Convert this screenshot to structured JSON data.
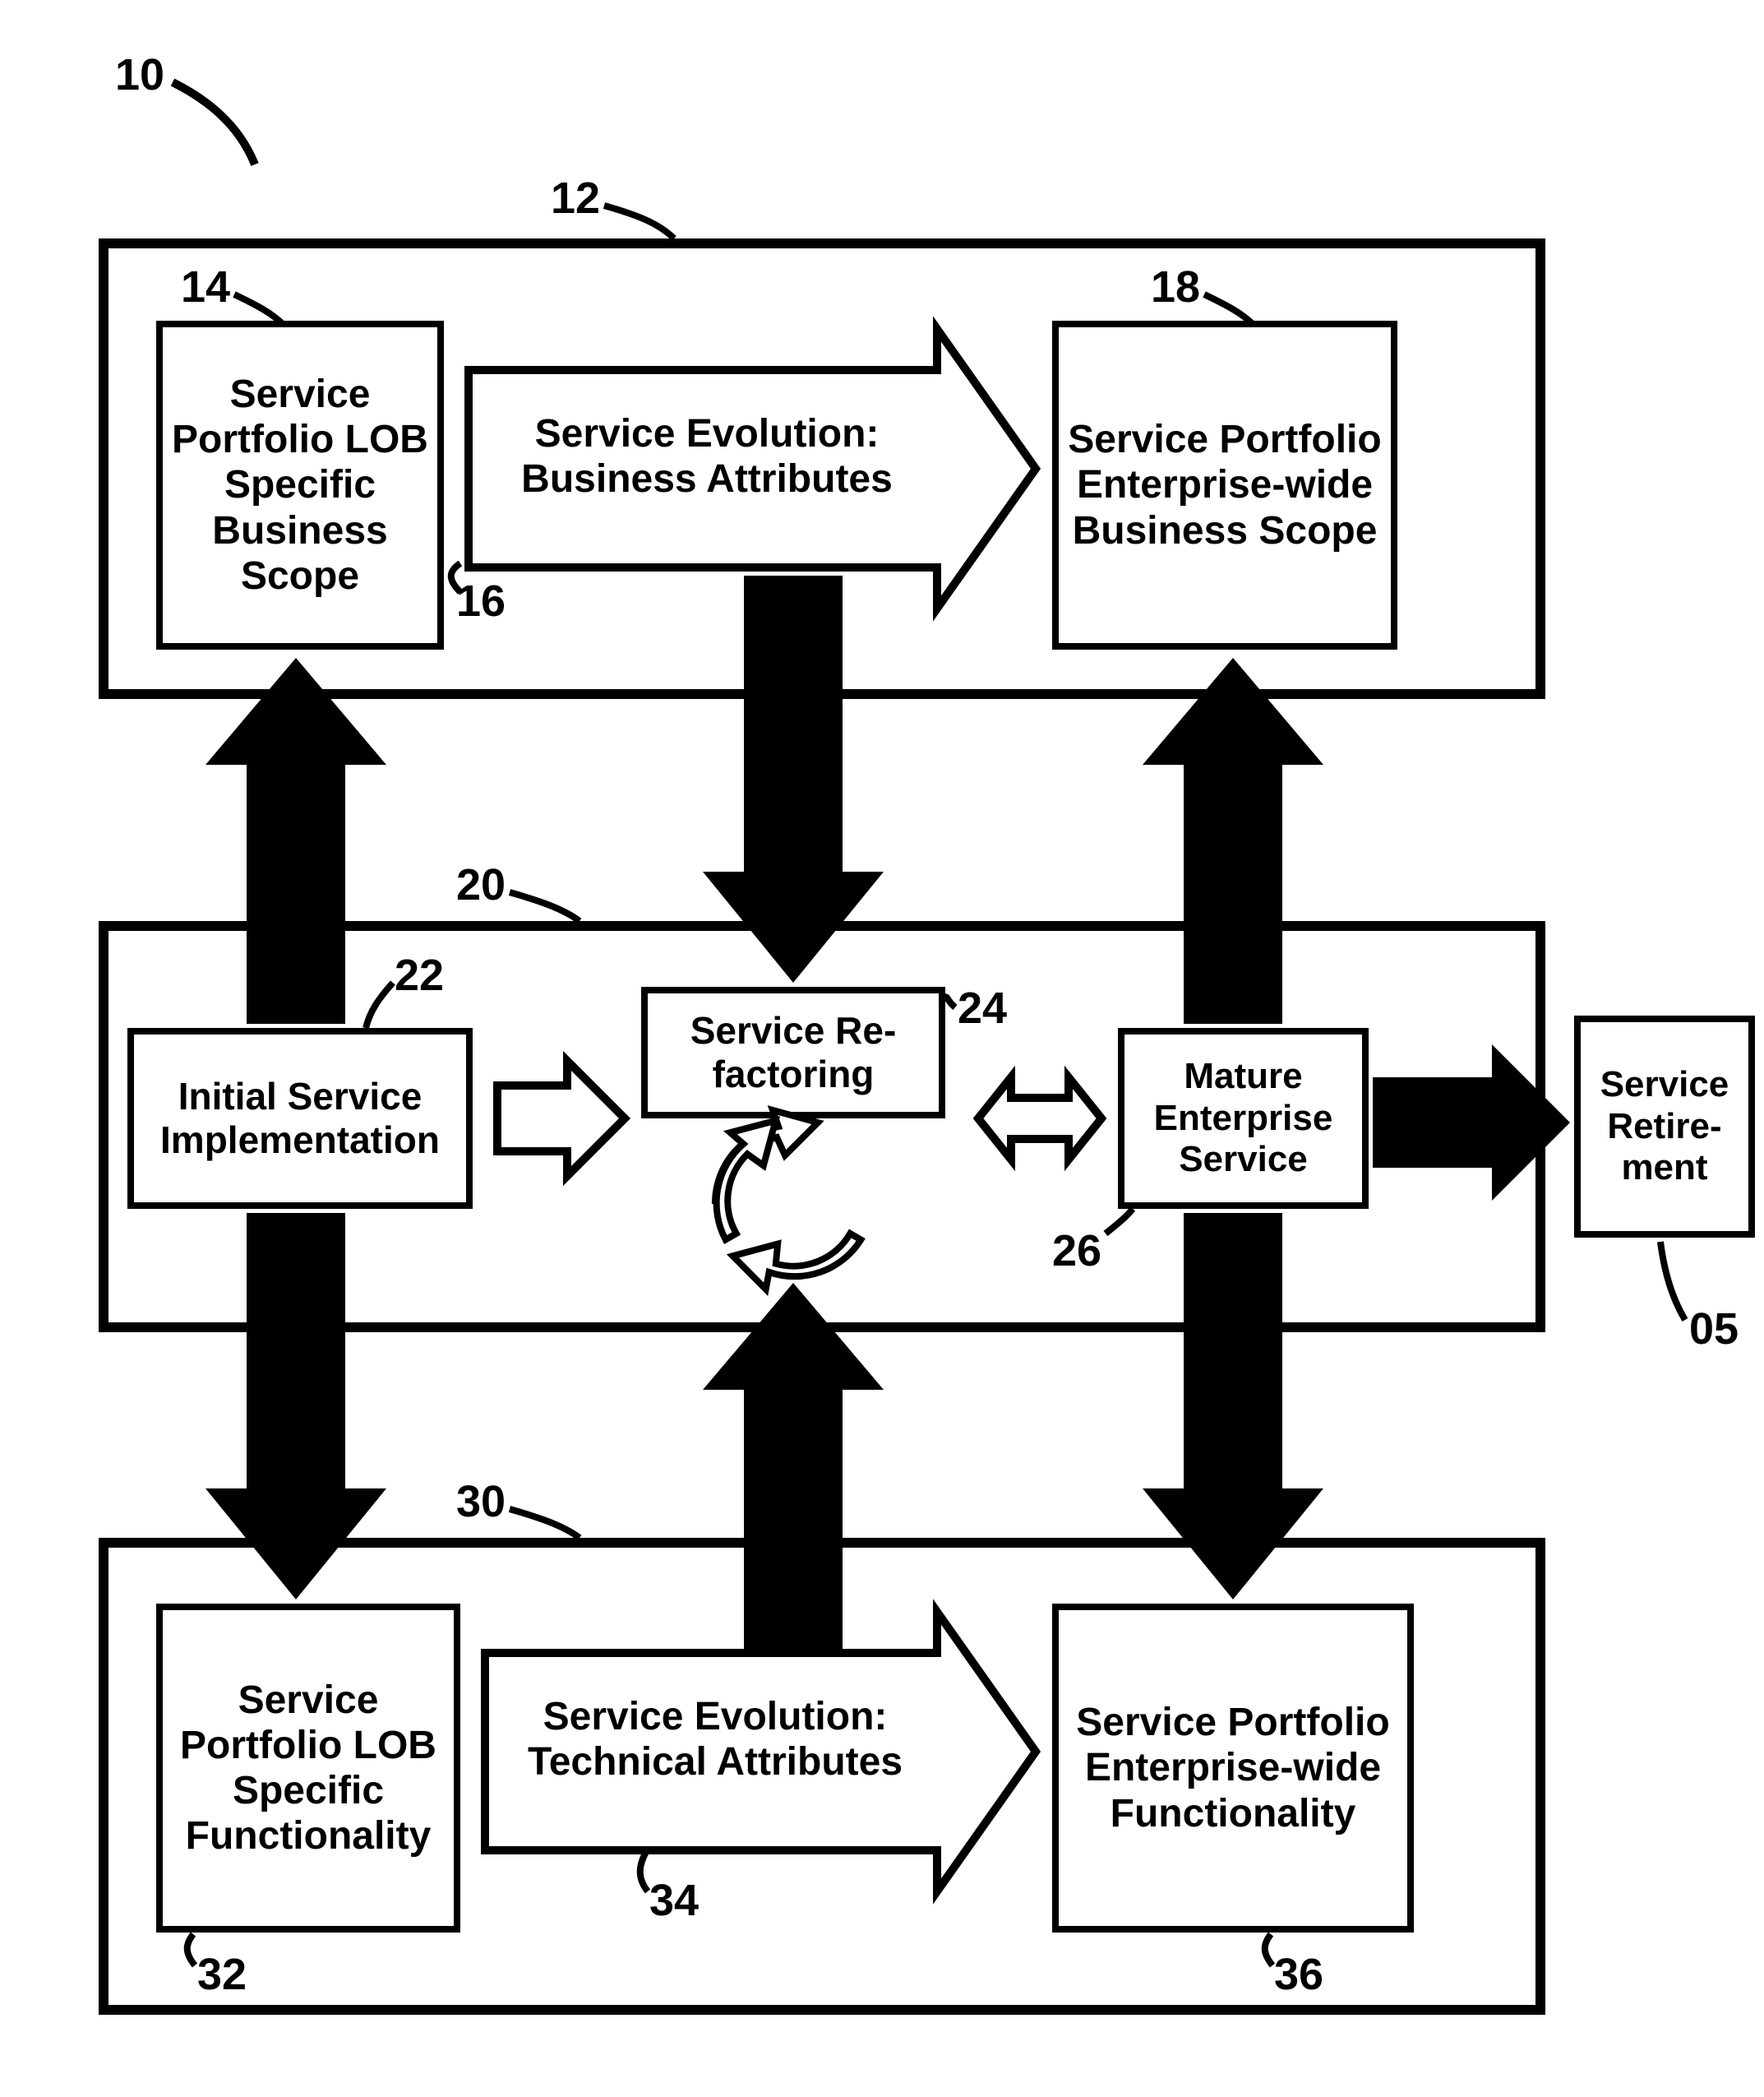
{
  "figure_ref": "10",
  "panels": {
    "top": {
      "ref": "12"
    },
    "mid": {
      "ref": "20"
    },
    "bot": {
      "ref": "30"
    }
  },
  "boxes": {
    "b14": {
      "ref": "14",
      "text": "Service Portfolio LOB Specific Business Scope"
    },
    "b18": {
      "ref": "18",
      "text": "Service Portfolio Enterprise-wide Business Scope"
    },
    "b22": {
      "ref": "22",
      "text": "Initial Service Implementation"
    },
    "b24": {
      "ref": "24",
      "text": "Service Re-factoring"
    },
    "b26": {
      "ref": "26",
      "text": "Mature Enterprise Service"
    },
    "b32": {
      "ref": "32",
      "text": "Service Portfolio LOB Specific Functionality"
    },
    "b36": {
      "ref": "36",
      "text": "Service Portfolio Enterprise-wide Functionality"
    },
    "b05": {
      "ref": "05",
      "text": "Service Retire-ment"
    }
  },
  "arrows": {
    "a16": {
      "ref": "16",
      "text": "Service Evolution: Business Attributes"
    },
    "a34": {
      "ref": "34",
      "text": "Service Evolution: Technical Attributes"
    }
  }
}
